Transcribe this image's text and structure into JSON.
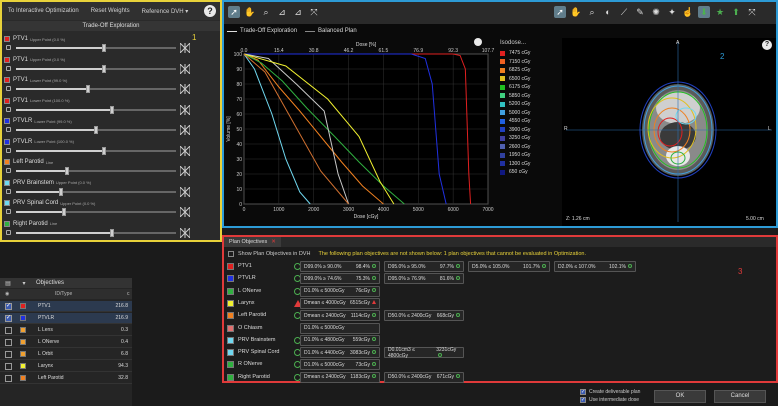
{
  "left_panel": {
    "tabs": [
      "To Interactive Optimization",
      "Reset Weights",
      "Reference DVH ▾"
    ],
    "help": "?",
    "title": "Trade-Off Exploration",
    "panel_number": "1",
    "sliders": [
      {
        "name": "PTV1",
        "sub": "Upper Point (0.0 %)",
        "color": "#e02020",
        "value": 0.55
      },
      {
        "name": "PTV1",
        "sub": "Upper Point (0.0 %)",
        "color": "#e02020",
        "value": 0.55
      },
      {
        "name": "PTV1",
        "sub": "Lower Point (99.0 %)",
        "color": "#e02020",
        "value": 0.45
      },
      {
        "name": "PTV1",
        "sub": "Lower Point (100.0 %)",
        "color": "#e02020",
        "value": 0.6
      },
      {
        "name": "PTVLR",
        "sub": "Lower Point (99.0 %)",
        "color": "#2030e0",
        "value": 0.5
      },
      {
        "name": "PTVLR",
        "sub": "Lower Point (100.0 %)",
        "color": "#2030e0",
        "value": 0.55
      },
      {
        "name": "Left Parotid",
        "sub": "Line",
        "color": "#f08020",
        "value": 0.32
      },
      {
        "name": "PRV Brainstem",
        "sub": "Upper Point (0.0 %)",
        "color": "#70d8f0",
        "value": 0.28
      },
      {
        "name": "PRV Spinal Cord",
        "sub": "Upper Point (0.0 %)",
        "color": "#70d8f0",
        "value": 0.3
      },
      {
        "name": "Right Parotid",
        "sub": "Line",
        "color": "#30b040",
        "value": 0.6
      }
    ]
  },
  "objectives_panel": {
    "title": "Objectives",
    "col_type": "ID/Type",
    "col_value": "c",
    "rows": [
      {
        "name": "PTV1",
        "value": "216.8",
        "color": "#e02020",
        "checked": true
      },
      {
        "name": "PTVLR",
        "value": "216.9",
        "color": "#2030e0",
        "checked": true
      },
      {
        "name": "L Lens",
        "value": "0.3",
        "color": "#f0a030",
        "checked": false
      },
      {
        "name": "L ONerve",
        "value": "0.4",
        "color": "#f0a030",
        "checked": false
      },
      {
        "name": "L Orbit",
        "value": "6.8",
        "color": "#f0a030",
        "checked": false
      },
      {
        "name": "Larynx",
        "value": "94.3",
        "color": "#f0f030",
        "checked": false
      },
      {
        "name": "Left Parotid",
        "value": "32.8",
        "color": "#f08020",
        "checked": false
      }
    ]
  },
  "chart_panel": {
    "panel_number": "2",
    "legend": [
      "Trade-Off Exploration",
      "Balanced Plan"
    ],
    "iso_title": "Isodose...",
    "isodoses": [
      {
        "label": "7475 cGy",
        "color": "#e02020"
      },
      {
        "label": "7150 cGy",
        "color": "#f06020"
      },
      {
        "label": "6825 cGy",
        "color": "#f08020"
      },
      {
        "label": "6500 cGy",
        "color": "#e0c020"
      },
      {
        "label": "6175 cGy",
        "color": "#20c020"
      },
      {
        "label": "5850 cGy",
        "color": "#40d080"
      },
      {
        "label": "5200 cGy",
        "color": "#30c0c0"
      },
      {
        "label": "5000 cGy",
        "color": "#40a0e0"
      },
      {
        "label": "4550 cGy",
        "color": "#2060e0"
      },
      {
        "label": "3900 cGy",
        "color": "#2040c0"
      },
      {
        "label": "3250 cGy",
        "color": "#4040a0"
      },
      {
        "label": "2600 cGy",
        "color": "#5060b0"
      },
      {
        "label": "1950 cGy",
        "color": "#3040a0"
      },
      {
        "label": "1300 cGy",
        "color": "#2030a0"
      },
      {
        "label": "650 cGy",
        "color": "#101880"
      }
    ],
    "ct_z_label": "Z: 1.26 cm",
    "ct_scale_label": "5.00 cm",
    "ct_orient": {
      "top": "A",
      "left": "R",
      "right": "L"
    }
  },
  "chart_data": {
    "type": "line",
    "title": "",
    "xlabel_top": "Dose [%]",
    "xlabel": "Dose [cGy]",
    "ylabel": "Volume [%]",
    "xlim": [
      0,
      7000
    ],
    "ylim": [
      0,
      100
    ],
    "x_ticks": [
      0,
      1000,
      2000,
      3000,
      4000,
      5000,
      6000,
      7000
    ],
    "y_ticks": [
      0,
      10,
      20,
      30,
      40,
      50,
      60,
      70,
      80,
      90,
      100
    ],
    "top_ticks": [
      "0.0",
      "15.4",
      "30.8",
      "46.2",
      "61.5",
      "76.9",
      "92.3",
      "107.7"
    ],
    "series": [
      {
        "color": "#e02020",
        "x": [
          0,
          6000,
          6200,
          6350,
          6450,
          6500
        ],
        "y": [
          100,
          100,
          99,
          90,
          20,
          0
        ]
      },
      {
        "color": "#2030e0",
        "x": [
          0,
          4800,
          5200,
          5400,
          5600,
          5800
        ],
        "y": [
          100,
          100,
          97,
          80,
          20,
          0
        ]
      },
      {
        "color": "#f08020",
        "x": [
          0,
          400,
          1000,
          1600,
          2200,
          2800,
          3400,
          4000
        ],
        "y": [
          100,
          96,
          78,
          62,
          45,
          28,
          12,
          0
        ]
      },
      {
        "color": "#30b040",
        "x": [
          0,
          500,
          1100,
          1800,
          2600,
          3300,
          4000,
          4600
        ],
        "y": [
          100,
          94,
          82,
          64,
          45,
          28,
          12,
          0
        ]
      },
      {
        "color": "#70d8f0",
        "x": [
          0,
          300,
          800,
          1200,
          1600,
          1900
        ],
        "y": [
          100,
          90,
          60,
          30,
          8,
          0
        ]
      },
      {
        "color": "#c8c8c8",
        "x": [
          0,
          700,
          1500,
          2300,
          2700,
          3000
        ],
        "y": [
          100,
          97,
          80,
          62,
          20,
          0
        ]
      },
      {
        "color": "#f0f030",
        "x": [
          0,
          1200,
          2400,
          3300,
          3900,
          4300
        ],
        "y": [
          100,
          92,
          70,
          45,
          15,
          0
        ]
      },
      {
        "color": "#d07030",
        "x": [
          0,
          600,
          1400,
          2200,
          3000
        ],
        "y": [
          100,
          88,
          55,
          22,
          0
        ]
      }
    ]
  },
  "plan_panel": {
    "panel_number": "3",
    "tab_label": "Plan Objectives",
    "show_label": "Show Plan Objectives in DVH",
    "warning": "The following plan objectives are not shown below: 1 plan objectives that cannot be evaluated in Optimization.",
    "rows": [
      {
        "name": "PTV1",
        "color": "#e02020",
        "status": "ok",
        "goals": [
          {
            "text": "D99.0% ≥ 90.0%",
            "value": "98.4%",
            "ok": true
          },
          {
            "text": "D95.0% ≥ 95.0%",
            "value": "97.7%",
            "ok": true
          },
          {
            "text": "D5.0% ≤ 105.0%",
            "value": "101.7%",
            "ok": true
          },
          {
            "text": "D2.0% ≤ 107.0%",
            "value": "102.1%",
            "ok": true
          }
        ]
      },
      {
        "name": "PTVLR",
        "color": "#2030e0",
        "status": "ok",
        "goals": [
          {
            "text": "D99.0% ≥ 74.6%",
            "value": "75.3%",
            "ok": true
          },
          {
            "text": "D95.0% ≥ 76.9%",
            "value": "81.6%",
            "ok": true
          }
        ]
      },
      {
        "name": "L ONerve",
        "color": "#30b040",
        "status": "ok",
        "goals": [
          {
            "text": "D1.0% ≤ 5000cGy",
            "value": "76cGy",
            "ok": true
          }
        ]
      },
      {
        "name": "Larynx",
        "color": "#f0f030",
        "status": "warn",
        "goals": [
          {
            "text": "Dmean ≤ 4000cGy",
            "value": "6515cGy",
            "ok": false
          }
        ]
      },
      {
        "name": "Left Parotid",
        "color": "#f08020",
        "status": "ok",
        "goals": [
          {
            "text": "Dmean ≤ 2400cGy",
            "value": "1114cGy",
            "ok": true
          },
          {
            "text": "D50.0% ≤ 2400cGy",
            "value": "668cGy",
            "ok": true
          }
        ]
      },
      {
        "name": "O Chiasm",
        "color": "#e07070",
        "status": "none",
        "goals": [
          {
            "text": "D1.0% ≤ 5000cGy",
            "value": "",
            "ok": true
          }
        ]
      },
      {
        "name": "PRV Brainstem",
        "color": "#70d8f0",
        "status": "ok",
        "goals": [
          {
            "text": "D1.0% ≤ 4800cGy",
            "value": "559cGy",
            "ok": true
          }
        ]
      },
      {
        "name": "PRV Spinal Cord",
        "color": "#70d8f0",
        "status": "ok",
        "goals": [
          {
            "text": "D1.0% ≤ 4400cGy",
            "value": "3083cGy",
            "ok": true
          },
          {
            "text": "D0.01cm3 ≤ 4800cGy",
            "value": "3231cGy",
            "ok": true
          }
        ]
      },
      {
        "name": "R ONerve",
        "color": "#30b040",
        "status": "ok",
        "goals": [
          {
            "text": "D1.0% ≤ 5000cGy",
            "value": "73cGy",
            "ok": true
          }
        ]
      },
      {
        "name": "Right Parotid",
        "color": "#30b040",
        "status": "ok",
        "goals": [
          {
            "text": "Dmean ≤ 2400cGy",
            "value": "1183cGy",
            "ok": true
          },
          {
            "text": "D50.0% ≤ 2400cGy",
            "value": "671cGy",
            "ok": true
          }
        ]
      }
    ]
  },
  "bottom_bar": {
    "create_label": "Create deliverable plan",
    "intermediate_label": "Use intermediate dose",
    "ok_label": "OK",
    "cancel_label": "Cancel"
  }
}
